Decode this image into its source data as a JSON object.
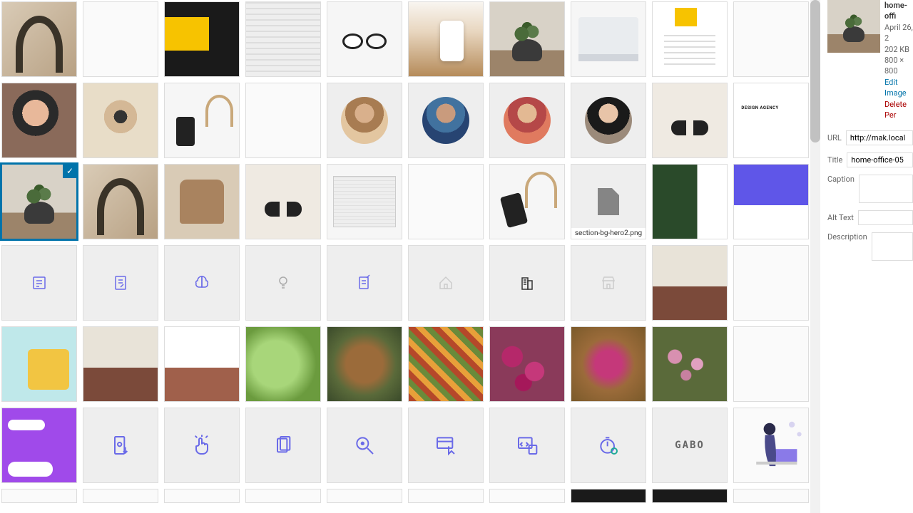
{
  "selected": {
    "name": "home-offi",
    "date": "April 26, 2",
    "size": "202 KB",
    "dims": "800 × 800",
    "edit": "Edit Image",
    "delete": "Delete Per"
  },
  "form": {
    "url_label": "URL",
    "url_value": "http://mak.local",
    "title_label": "Title",
    "title_value": "home-office-05",
    "caption_label": "Caption",
    "alt_label": "Alt Text",
    "desc_label": "Description"
  },
  "filenames": {
    "placeholder": "section-bg-hero2.png"
  },
  "logo": "GABO"
}
